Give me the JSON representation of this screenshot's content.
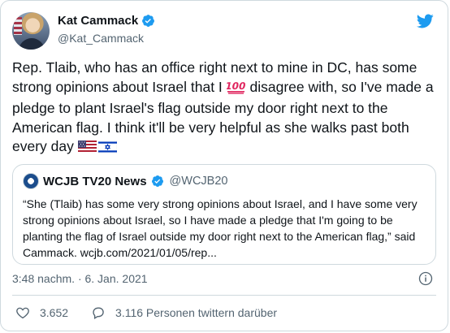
{
  "author": {
    "display_name": "Kat Cammack",
    "handle": "@Kat_Cammack",
    "verified": true
  },
  "tweet": {
    "text_before_emoji": "Rep. Tlaib, who has an office right next to mine in DC, has some strong opinions about Israel that I ",
    "emoji_hundred": "💯",
    "text_after_emoji": " disagree with, so I've made a pledge to plant Israel's flag outside my door right next to the American flag. I think it'll be very helpful as she walks past both every day ",
    "emoji_flags": [
      "us-flag-icon",
      "israel-flag-icon"
    ]
  },
  "quoted_tweet": {
    "display_name": "WCJB TV20 News",
    "handle": "@WCJB20",
    "verified": true,
    "text": "“She (Tlaib) has some very strong opinions about Israel, and I have some very strong opinions about Israel, so I have made a pledge that I'm going to be planting the flag of Israel outside my door right next to the American flag,” said Cammack. wcjb.com/2021/01/05/rep..."
  },
  "meta": {
    "timestamp": "3:48 nachm. · 6. Jan. 2021"
  },
  "actions": {
    "likes_count": "3.652",
    "replies_label": "3.116 Personen twittern darüber"
  },
  "colors": {
    "twitter_blue": "#1d9bf0",
    "secondary_text": "#536471",
    "border": "#cfd9de"
  }
}
